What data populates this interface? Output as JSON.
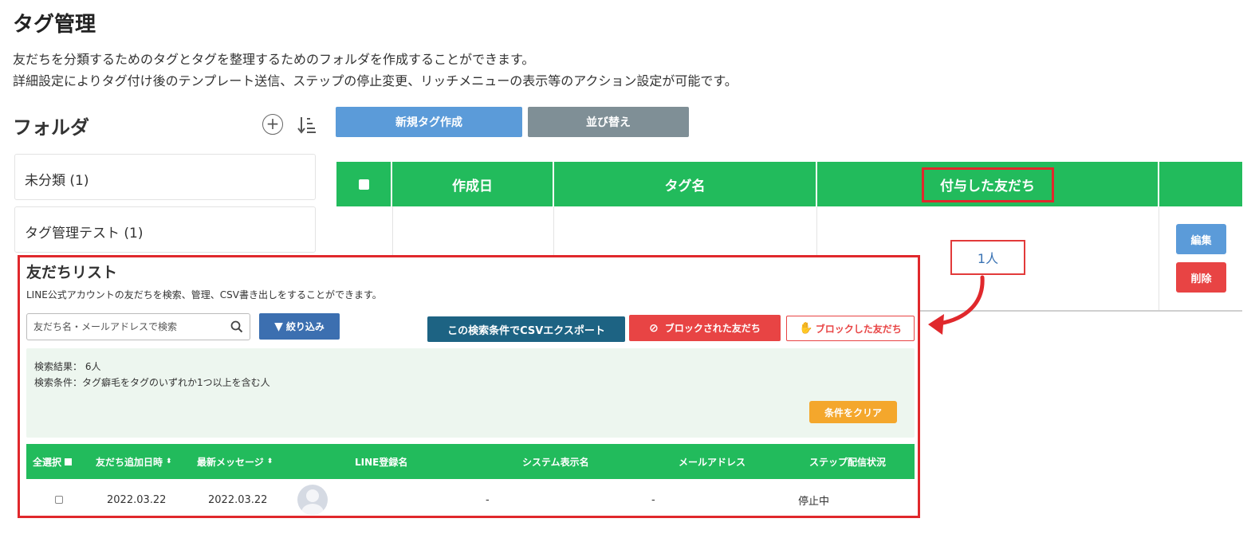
{
  "page": {
    "title": "タグ管理",
    "description_1": "友だちを分類するためのタグとタグを整理するためのフォルダを作成することができます。",
    "description_2": "詳細設定によりタグ付け後のテンプレート送信、ステップの停止変更、リッチメニューの表示等のアクション設定が可能です。"
  },
  "folders": {
    "title": "フォルダ",
    "items": [
      {
        "label": "未分類 (1)"
      },
      {
        "label": "タグ管理テスト (1)"
      }
    ]
  },
  "toolbar": {
    "new_tag_label": "新規タグ作成",
    "sort_label": "並び替え"
  },
  "tag_table": {
    "headers": {
      "created": "作成日",
      "tag_name": "タグ名",
      "friends": "付与した友だち"
    },
    "row": {
      "friend_count": "1人",
      "edit_label": "編集",
      "delete_label": "削除"
    }
  },
  "friends_panel": {
    "title": "友だちリスト",
    "description": "LINE公式アカウントの友だちを検索、管理、CSV書き出しをすることができます。",
    "search_placeholder": "友だち名・メールアドレスで検索",
    "filter_label": "絞り込み",
    "csv_label": "この検索条件でCSVエクスポート",
    "blocked_by_label": "ブロックされた友だち",
    "blocked_label": "ブロックした友だち",
    "result_count": "検索結果： 6人",
    "result_condition": "検索条件：タグ癖毛をタグのいずれか1つ以上を含む人",
    "clear_label": "条件をクリア",
    "columns": {
      "select_all": "全選択",
      "added_at": "友だち追加日時",
      "last_message": "最新メッセージ",
      "line_name": "LINE登録名",
      "system_name": "システム表示名",
      "email": "メールアドレス",
      "step_status": "ステップ配信状況"
    },
    "rows": [
      {
        "added_at": "2022.03.22",
        "last_message": "2022.03.22",
        "system_name": "-",
        "email": "-",
        "step_status": "停止中"
      }
    ]
  },
  "colors": {
    "green": "#22bb5c",
    "blue": "#5b9bd9",
    "red_highlight": "#e0282c",
    "dark_teal": "#1d6383",
    "orange": "#f4a72c"
  }
}
